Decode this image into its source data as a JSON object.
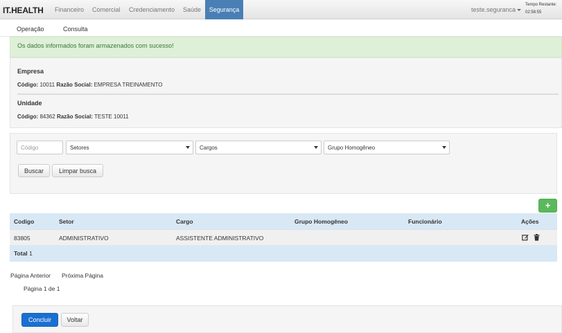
{
  "navbar": {
    "brand": "IT.HEALTH",
    "items": [
      "Financeiro",
      "Comercial",
      "Credenciamento",
      "Saúde"
    ],
    "active_item": "Segurança",
    "user": "teste.seguranca",
    "timer_label": "Tempo Restante:",
    "timer_value": "02:58:55"
  },
  "subnav": {
    "items": [
      "Operação",
      "Consulta"
    ]
  },
  "alert": {
    "message": "Os dados informados foram armazenados com sucesso!"
  },
  "empresa": {
    "title": "Empresa",
    "codigo_label": "Código:",
    "codigo_value": "10011",
    "razao_label": "Razão Social:",
    "razao_value": "EMPRESA TREINAMENTO"
  },
  "unidade": {
    "title": "Unidade",
    "codigo_label": "Código:",
    "codigo_value": "84362",
    "razao_label": "Razão Social:",
    "razao_value": "TESTE 10011"
  },
  "filters": {
    "codigo_placeholder": "Código",
    "setores": "Setores",
    "cargos": "Cargos",
    "grupo": "Grupo Homogêneo",
    "search_button": "Buscar",
    "clear_button": "Limpar busca"
  },
  "table": {
    "add_button": "+",
    "headers": [
      "Codigo",
      "Setor",
      "Cargo",
      "Grupo Homogêneo",
      "Funcionário",
      "Ações"
    ],
    "rows": [
      {
        "codigo": "83805",
        "setor": "ADMINISTRATIVO",
        "cargo": "ASSISTENTE ADMINISTRATIVO",
        "grupo": "",
        "funcionario": ""
      }
    ],
    "total_label": "Total",
    "total_value": "1"
  },
  "pagination": {
    "prev": "Página Anterior",
    "next": "Próxima Página",
    "info": "Página 1 de 1"
  },
  "actions": {
    "conclude": "Concluir",
    "back": "Voltar"
  },
  "colors": {
    "nav_active": "#4a7fb5",
    "alert_bg": "#dff0d8",
    "alert_text": "#3c763d",
    "table_header": "#d9e8f5",
    "add_button": "#5cb85c",
    "primary_button": "#1a6fd1"
  }
}
